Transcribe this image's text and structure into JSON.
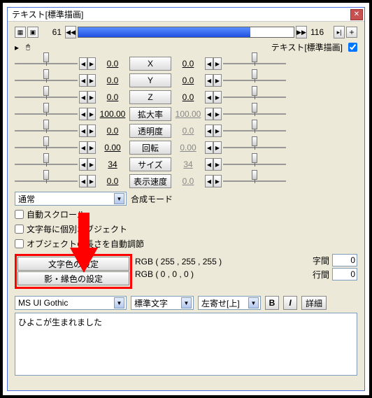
{
  "window": {
    "title": "テキスト[標準描画]"
  },
  "timeline": {
    "start": 61,
    "end": 116
  },
  "subheader": {
    "label": "テキスト[標準描画]"
  },
  "params": [
    {
      "name": "X",
      "left": "0.0",
      "right": "0.0"
    },
    {
      "name": "Y",
      "left": "0.0",
      "right": "0.0"
    },
    {
      "name": "Z",
      "left": "0.0",
      "right": "0.0"
    },
    {
      "name": "拡大率",
      "left": "100.00",
      "right": "100.00"
    },
    {
      "name": "透明度",
      "left": "0.0",
      "right": "0.0"
    },
    {
      "name": "回転",
      "left": "0.00",
      "right": "0.00"
    },
    {
      "name": "サイズ",
      "left": "34",
      "right": "34"
    },
    {
      "name": "表示速度",
      "left": "0.0",
      "right": "0.0"
    }
  ],
  "blend": {
    "label": "合成モード",
    "value": "通常"
  },
  "checks": {
    "auto_scroll": "自動スクロール",
    "per_char": "文字毎に個別オブジェクト",
    "auto_length": "オブジェクトの長さを自動調節"
  },
  "colors": {
    "text_btn": "文字色の設定",
    "shadow_btn": "影・縁色の設定",
    "text_rgb": "RGB ( 255 , 255 , 255 )",
    "shadow_rgb": "RGB ( 0 , 0 , 0 )"
  },
  "spacing": {
    "char_label": "字間",
    "char_value": "0",
    "line_label": "行間",
    "line_value": "0"
  },
  "font": {
    "family": "MS UI Gothic",
    "style": "標準文字",
    "align": "左寄せ[上]",
    "bold": "B",
    "italic": "I",
    "detail": "詳細"
  },
  "text": {
    "value": "ひよこが生まれました"
  }
}
